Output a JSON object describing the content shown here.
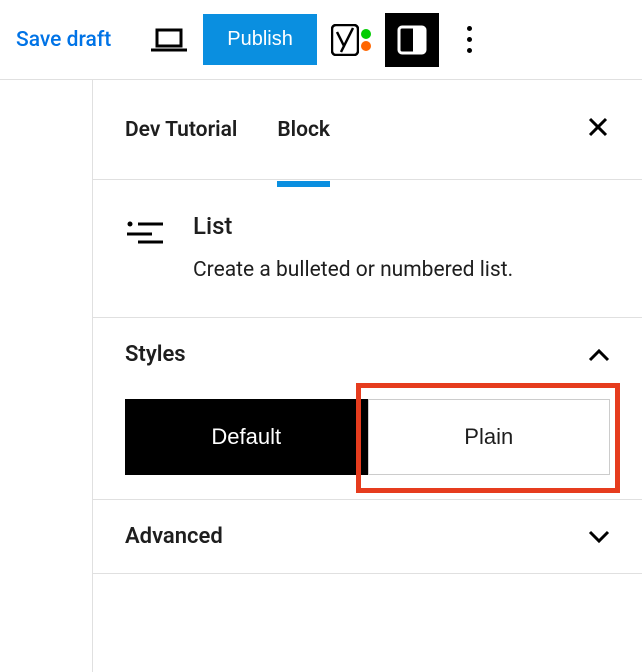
{
  "toolbar": {
    "saveDraft": "Save draft",
    "publish": "Publish"
  },
  "tabs": {
    "tab1": "Dev Tutorial",
    "tab2": "Block"
  },
  "block": {
    "title": "List",
    "description": "Create a bulleted or numbered list."
  },
  "sections": {
    "styles": {
      "title": "Styles",
      "option1": "Default",
      "option2": "Plain"
    },
    "advanced": {
      "title": "Advanced"
    }
  }
}
